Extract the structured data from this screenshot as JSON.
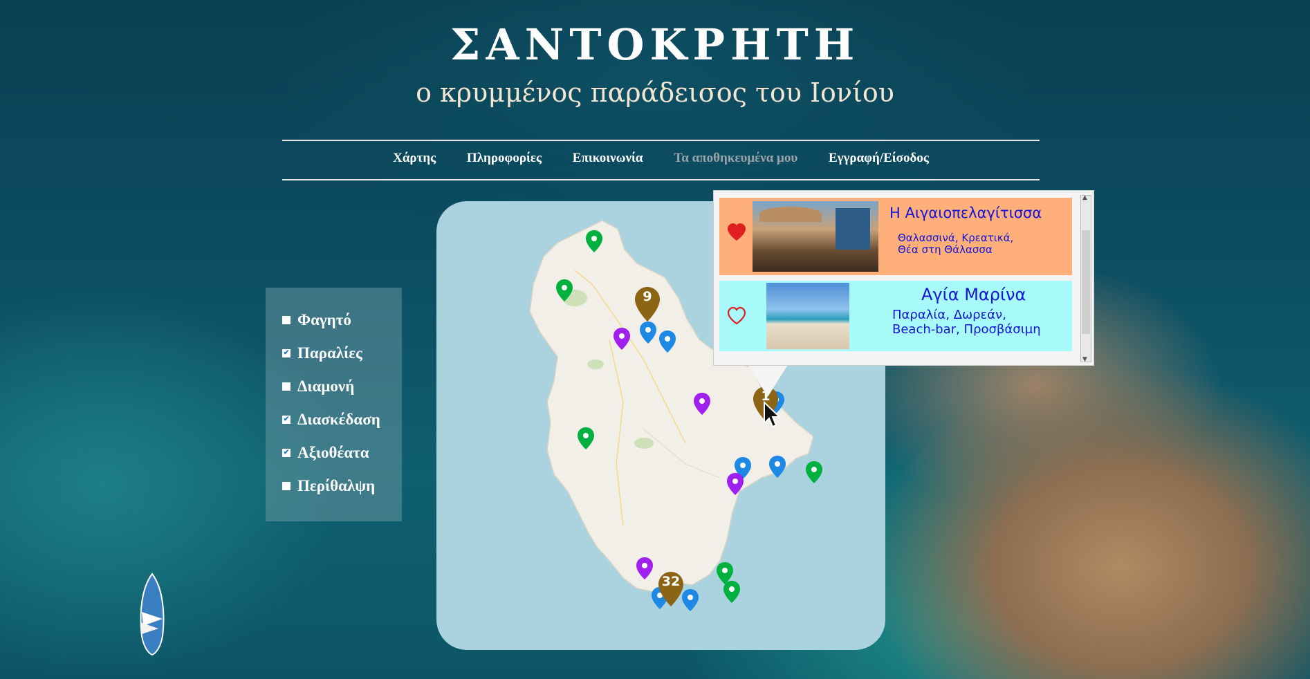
{
  "header": {
    "title": "ΣΑΝΤΟΚΡΗΤΗ",
    "subtitle": "ο κρυμμένος παράδεισος του Ιονίου"
  },
  "nav": {
    "items": [
      {
        "label": "Χάρτης",
        "muted": false
      },
      {
        "label": "Πληροφορίες",
        "muted": false
      },
      {
        "label": "Επικοινωνία",
        "muted": false
      },
      {
        "label": "Τα αποθηκευμένα μου",
        "muted": true
      },
      {
        "label": "Εγγραφή/Είσοδος",
        "muted": false
      }
    ]
  },
  "filters": [
    {
      "label": "Φαγητό",
      "checked": false
    },
    {
      "label": "Παραλίες",
      "checked": true
    },
    {
      "label": "Διαμονή",
      "checked": false
    },
    {
      "label": "Διασκέδαση",
      "checked": true
    },
    {
      "label": "Αξιοθέατα",
      "checked": true
    },
    {
      "label": "Περίθαλψη",
      "checked": false
    }
  ],
  "map": {
    "clusters": [
      {
        "label": "9"
      },
      {
        "label": "32"
      },
      {
        "label": "1"
      }
    ],
    "colors": {
      "sea": "#aad3df",
      "land": "#f2efe9",
      "beach": "#1e88e5",
      "sight": "#00b140",
      "fun": "#a020f0",
      "cluster": "#8b6416"
    }
  },
  "popup": {
    "cards": [
      {
        "name": "Η Αιγαιοπελαγίτισσα",
        "desc1": "Θαλασσινά, Κρεατικά,",
        "desc2": "Θέα στη Θάλασσα",
        "saved": true,
        "bg": "#ffb07a"
      },
      {
        "name": "Αγία Μαρίνα",
        "desc1": "Παραλία, Δωρεάν,",
        "desc2": "Beach-bar, Προσβάσιμη",
        "saved": false,
        "bg": "#a8fafa"
      }
    ]
  }
}
